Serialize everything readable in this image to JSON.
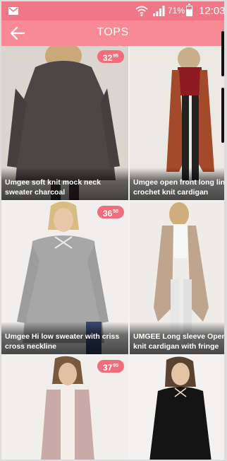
{
  "status_bar": {
    "battery_percent": "71%",
    "battery_level": 0.71,
    "time": "12:03"
  },
  "app_bar": {
    "title": "TOPS",
    "back_icon": "arrow-left-icon"
  },
  "colors": {
    "status_bar": "#f07886",
    "app_bar": "#f78a94",
    "price_badge": "#f26c7b"
  },
  "products": [
    {
      "name": "Umgee soft knit mock neck sweater charcoal",
      "line1": "Umgee soft knit mock neck",
      "line2": "sweater charcoal",
      "price_main": "32",
      "price_cents": "95"
    },
    {
      "name": "Umgee open front long line crochet knit cardigan",
      "line1": "Umgee open front long lin",
      "line2": "crochet knit cardigan",
      "price_main": "",
      "price_cents": ""
    },
    {
      "name": "Umgee Hi low sweater with criss cross neckline",
      "line1": "Umgee Hi low sweater with criss",
      "line2": "cross neckline",
      "price_main": "36",
      "price_cents": "50"
    },
    {
      "name": "UMGEE Long sleeve Open knit cardigan with fringe",
      "line1": "UMGEE Long sleeve Open",
      "line2": "knit cardigan with fringe",
      "price_main": "",
      "price_cents": ""
    },
    {
      "name": "",
      "line1": "",
      "line2": "",
      "price_main": "37",
      "price_cents": "95"
    },
    {
      "name": "",
      "line1": "",
      "line2": "",
      "price_main": "",
      "price_cents": ""
    }
  ]
}
